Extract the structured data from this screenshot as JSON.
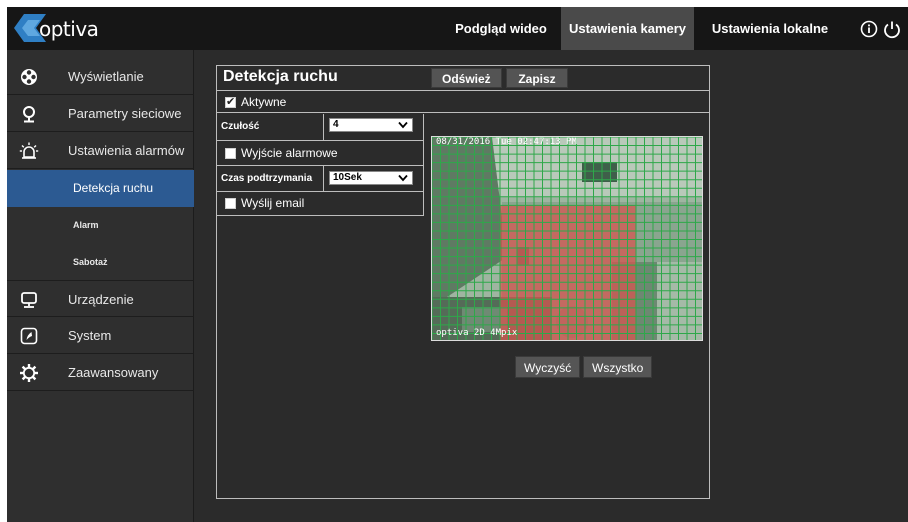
{
  "brand": {
    "logo_text": "optiva"
  },
  "topnav": {
    "items": [
      {
        "label": "Podgląd wideo"
      },
      {
        "label": "Ustawienia kamery"
      },
      {
        "label": "Ustawienia lokalne"
      }
    ],
    "active_index": 1
  },
  "topbar_icons": [
    "info-icon",
    "power-icon"
  ],
  "sidebar": {
    "items": [
      {
        "label": "Wyświetlanie",
        "icon": "display-icon"
      },
      {
        "label": "Parametry sieciowe",
        "icon": "network-icon"
      },
      {
        "label": "Ustawienia alarmów",
        "icon": "alarm-icon"
      },
      {
        "label": "Urządzenie",
        "icon": "device-icon"
      },
      {
        "label": "System",
        "icon": "system-icon"
      },
      {
        "label": "Zaawansowany",
        "icon": "gear-icon"
      }
    ],
    "subitems": [
      {
        "label": "Detekcja ruchu",
        "active": true
      },
      {
        "label": "Alarm"
      },
      {
        "label": "Sabotaż"
      }
    ]
  },
  "panel": {
    "title": "Detekcja ruchu",
    "refresh_label": "Odśwież",
    "save_label": "Zapisz",
    "active_label": "Aktywne",
    "active_checked": true,
    "sensitivity_label": "Czułość",
    "sensitivity_value": "4",
    "alarm_output_label": "Wyjście alarmowe",
    "alarm_output_checked": false,
    "hold_time_label": "Czas podtrzymania",
    "hold_time_value": "10Sek",
    "send_email_label": "Wyślij email",
    "send_email_checked": false,
    "clear_label": "Wyczyść",
    "all_label": "Wszystko"
  },
  "video": {
    "timestamp": "08/31/2016 Tue 02:47:13 PM",
    "caption": "optiva 2D 4Mpix",
    "grid_color": "#2ea84a",
    "zone_color": "#d9534f"
  },
  "colors": {
    "topbar": "#161616",
    "active_tab": "#4a4a4a",
    "active_subitem": "#2c5a92",
    "panel_bg": "#2b2b2b"
  }
}
